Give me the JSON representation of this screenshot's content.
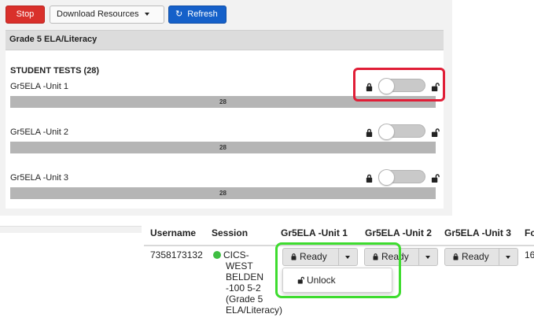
{
  "toolbar": {
    "stop_label": "Stop",
    "download_label": "Download Resources",
    "refresh_label": "Refresh"
  },
  "section": {
    "title": "Grade 5 ELA/Literacy"
  },
  "student_tests": {
    "heading": "STUDENT TESTS (28)",
    "tests": [
      {
        "name": "Gr5ELA -Unit 1",
        "count": "28",
        "locked": true
      },
      {
        "name": "Gr5ELA -Unit 2",
        "count": "28",
        "locked": true
      },
      {
        "name": "Gr5ELA -Unit 3",
        "count": "28",
        "locked": true
      }
    ]
  },
  "table": {
    "headers": [
      "Username",
      "Session",
      "Gr5ELA -Unit 1",
      "Gr5ELA -Unit 2",
      "Gr5ELA -Unit 3",
      "Fo"
    ],
    "row": {
      "username": "7358173132",
      "session_lines": [
        "CICS-",
        "WEST",
        "BELDEN",
        "-100 5-2",
        "(Grade 5",
        "ELA/Literacy)"
      ],
      "session_status_color": "#3fbe43",
      "unit_statuses": [
        "Ready",
        "Ready",
        "Ready"
      ],
      "last_cell": "16"
    }
  },
  "dropdown": {
    "unlock_label": "Unlock"
  },
  "colors": {
    "stop": "#d9302b",
    "refresh": "#1560c9",
    "highlight_red": "#e01e37",
    "highlight_green": "#3edc2f"
  },
  "icons": [
    "refresh-icon",
    "caret-down-icon",
    "lock-icon",
    "unlock-icon",
    "status-dot-icon"
  ]
}
